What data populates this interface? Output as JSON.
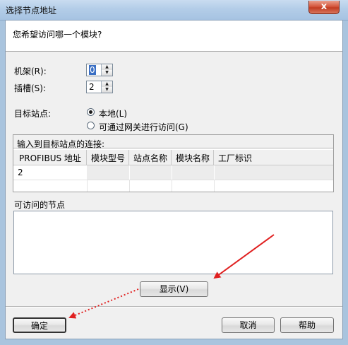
{
  "window": {
    "title": "选择节点地址",
    "close_glyph": "x"
  },
  "header": {
    "question": "您希望访问哪一个模块?"
  },
  "rack": {
    "label": "机架(R):",
    "value": "0"
  },
  "slot": {
    "label": "插槽(S):",
    "value": "2"
  },
  "target": {
    "label": "目标站点:",
    "options": [
      {
        "label": "本地(L)",
        "selected": true
      },
      {
        "label": "可通过网关进行访问(G)",
        "selected": false
      }
    ]
  },
  "connection": {
    "title": "输入到目标站点的连接:",
    "columns": [
      "PROFIBUS 地址",
      "模块型号",
      "站点名称",
      "模块名称",
      "工厂标识"
    ],
    "rows": [
      [
        "2",
        "",
        "",
        "",
        ""
      ]
    ]
  },
  "nodes": {
    "label": "可访问的节点"
  },
  "buttons": {
    "display": "显示(V)",
    "ok": "确定",
    "cancel": "取消",
    "help": "帮助"
  },
  "colors": {
    "arrow": "#e02020"
  }
}
